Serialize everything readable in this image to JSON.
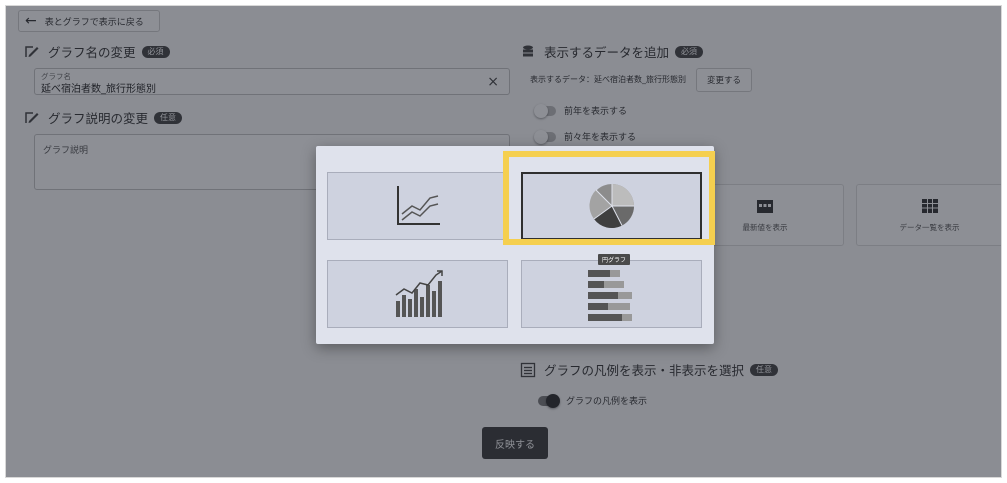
{
  "header": {
    "back_label": "表とグラフで表示に戻る"
  },
  "graph_name": {
    "title": "グラフ名の変更",
    "badge": "必須",
    "field_label": "グラフ名",
    "field_value": "延べ宿泊者数_旅行形態別",
    "clear_icon": "×"
  },
  "graph_desc": {
    "title": "グラフ説明の変更",
    "badge": "任意",
    "placeholder": "グラフ説明"
  },
  "add_data": {
    "title": "表示するデータを追加",
    "badge": "必須",
    "data_text": "表示するデータ：延べ宿泊者数_旅行形態別",
    "change_button": "変更する",
    "toggle_prev_year": "前年を表示する",
    "toggle_prev2_year": "前々年を表示する"
  },
  "display_cards": [
    {
      "label": "最新値を表示",
      "icon": "calendar-icon"
    },
    {
      "label": "データ一覧を表示",
      "icon": "table-icon"
    }
  ],
  "legend": {
    "title": "グラフの凡例を表示・非表示を選択",
    "badge": "任意",
    "toggle_label": "グラフの凡例を表示"
  },
  "apply_button": "反映する",
  "chart_type_picker": {
    "options": [
      {
        "name": "line-chart",
        "icon": "line-chart-icon"
      },
      {
        "name": "pie-chart",
        "icon": "pie-chart-icon",
        "selected": true
      },
      {
        "name": "bar-line-chart",
        "icon": "bar-line-chart-icon"
      },
      {
        "name": "stacked-bar-chart",
        "icon": "stacked-bar-chart-icon"
      }
    ],
    "tooltip": "円グラフ"
  },
  "colors": {
    "highlight": "#f5cf4f",
    "overlay": "#1c202c"
  }
}
